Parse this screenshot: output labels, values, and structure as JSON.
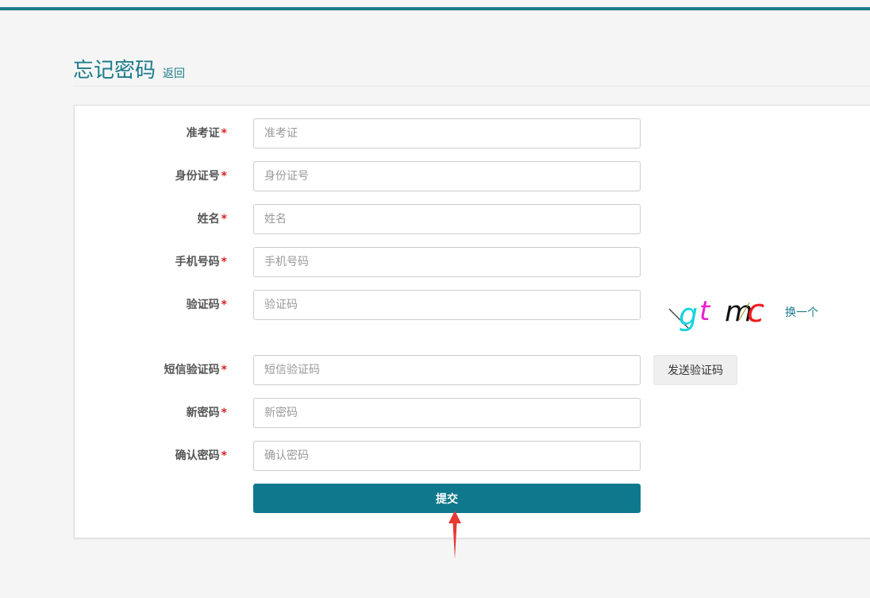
{
  "header": {
    "title": "忘记密码",
    "back_label": "返回"
  },
  "form": {
    "required_mark": "*",
    "fields": [
      {
        "label": "准考证",
        "placeholder": "准考证",
        "value": ""
      },
      {
        "label": "身份证号",
        "placeholder": "身份证号",
        "value": ""
      },
      {
        "label": "姓名",
        "placeholder": "姓名",
        "value": ""
      },
      {
        "label": "手机号码",
        "placeholder": "手机号码",
        "value": ""
      },
      {
        "label": "验证码",
        "placeholder": "验证码",
        "value": ""
      },
      {
        "label": "短信验证码",
        "placeholder": "短信验证码",
        "value": ""
      },
      {
        "label": "新密码",
        "placeholder": "新密码",
        "value": ""
      },
      {
        "label": "确认密码",
        "placeholder": "确认密码",
        "value": ""
      }
    ],
    "captcha": {
      "chars": [
        "g",
        "t",
        "m",
        "c"
      ],
      "colors": [
        "#19d3e0",
        "#e81fd0",
        "#111111",
        "#ee1a1a"
      ],
      "refresh_label": "换一个"
    },
    "sms_button_label": "发送验证码",
    "submit_label": "提交"
  },
  "colors": {
    "accent": "#1a7a8a",
    "button": "#0f788c",
    "required": "#e02020",
    "annotation_arrow": "#e53935"
  }
}
